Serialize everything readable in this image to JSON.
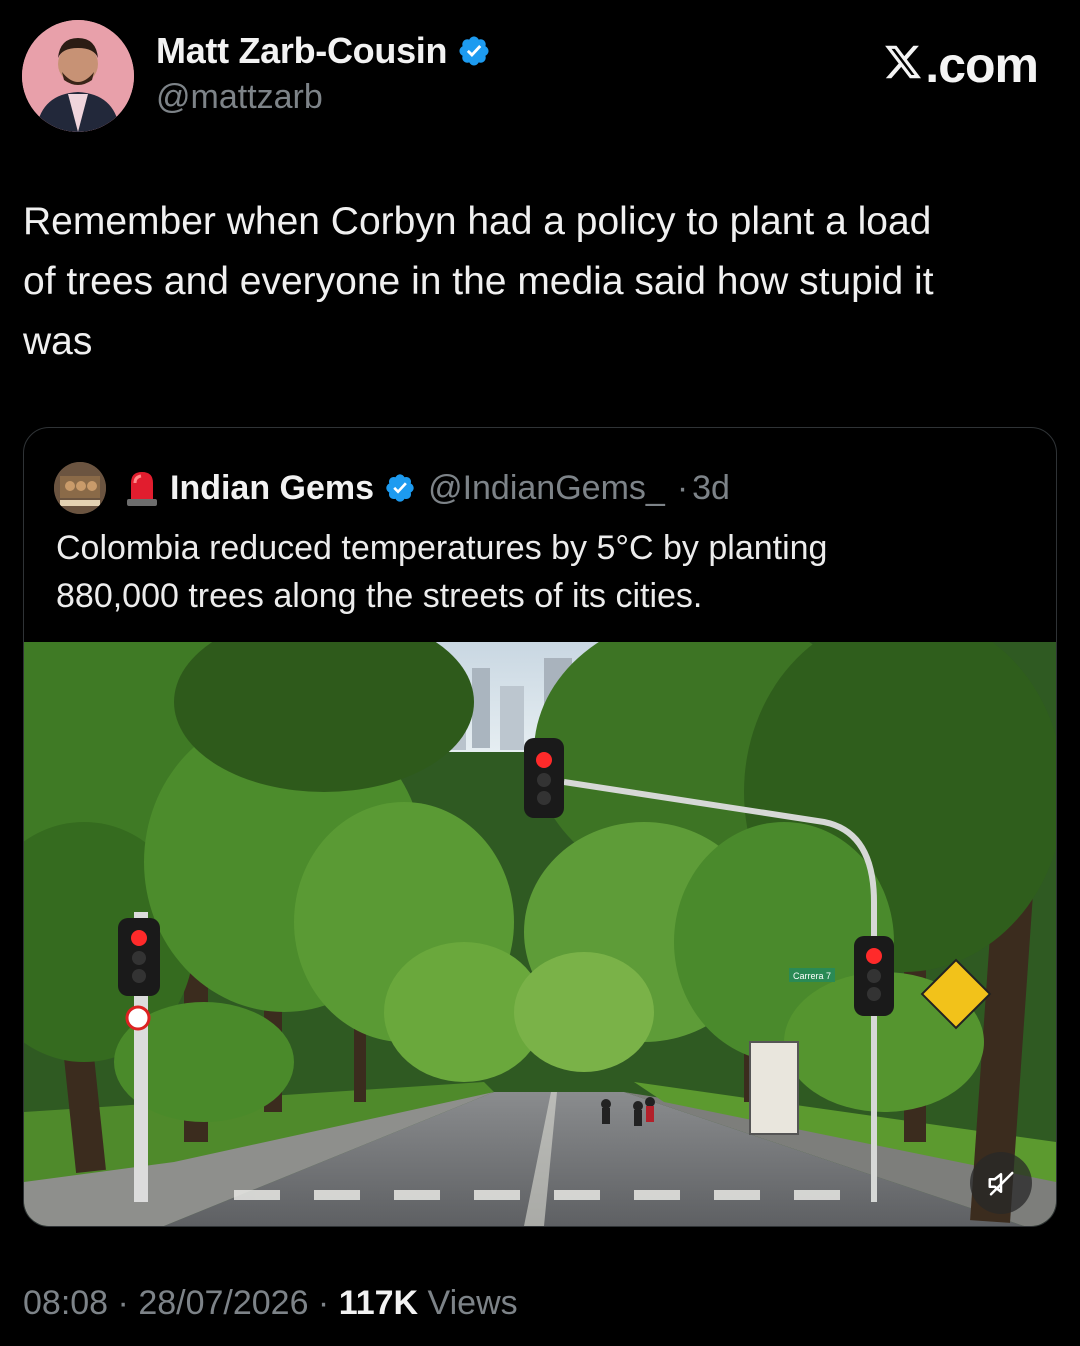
{
  "author": {
    "name": "Matt Zarb-Cousin",
    "handle": "@mattzarb",
    "verified": true
  },
  "site_label": ".com",
  "tweet": {
    "text": "Remember when Corbyn had a policy to plant a load\nof trees and everyone in the media said how stupid it\nwas"
  },
  "quoted": {
    "name": "Indian Gems",
    "handle": "@IndianGems_",
    "separator": "·",
    "age": "3d",
    "verified": true,
    "text": "Colombia reduced temperatures by 5°C by planting\n880,000 trees along the streets of its cities.",
    "media": {
      "street_sign": "Carrera 7"
    }
  },
  "meta": {
    "time": "08:08",
    "sep1": " · ",
    "date": "28/07/2026",
    "sep2": " · ",
    "views_count": "117K",
    "views_label": " Views"
  },
  "colors": {
    "background": "#000000",
    "text": "#e7e9ea",
    "muted": "#7d8388",
    "verified": "#1d9bf0",
    "border": "#2f3336"
  }
}
